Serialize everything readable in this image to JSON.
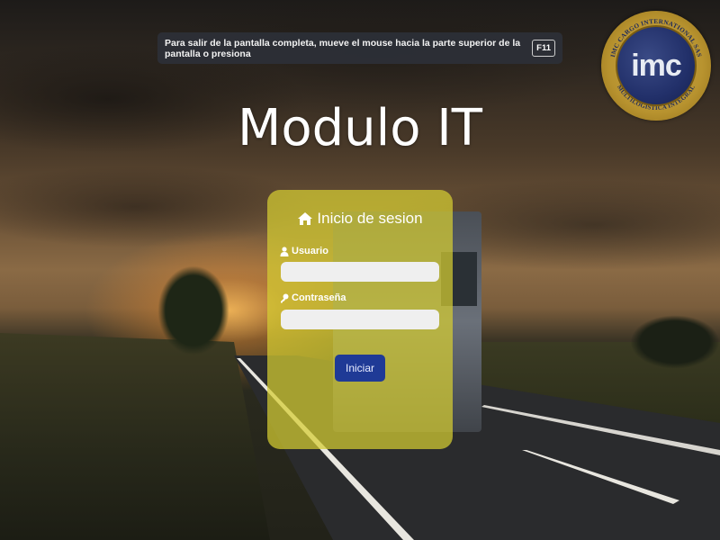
{
  "fullscreen_notice": {
    "text": "Para salir de la pantalla completa, mueve el mouse hacia la parte superior de la pantalla o presiona",
    "key": "F11"
  },
  "logo": {
    "text": "imc",
    "ring_top": "IMC CARGO INTERNATIONAL SAS",
    "ring_bottom": "MULTILOGISTICA INTEGRAL"
  },
  "title": "Modulo IT",
  "login": {
    "heading": "Inicio de sesion",
    "heading_icon": "home-icon",
    "username_label": "Usuario",
    "username_icon": "user-icon",
    "username_value": "",
    "password_label": "Contraseña",
    "password_icon": "key-icon",
    "password_value": "",
    "submit_label": "Iniciar"
  },
  "colors": {
    "panel": "#d6cd32",
    "button": "#1f3a96",
    "logo_gold": "#c9a54a",
    "logo_blue": "#22306a"
  }
}
